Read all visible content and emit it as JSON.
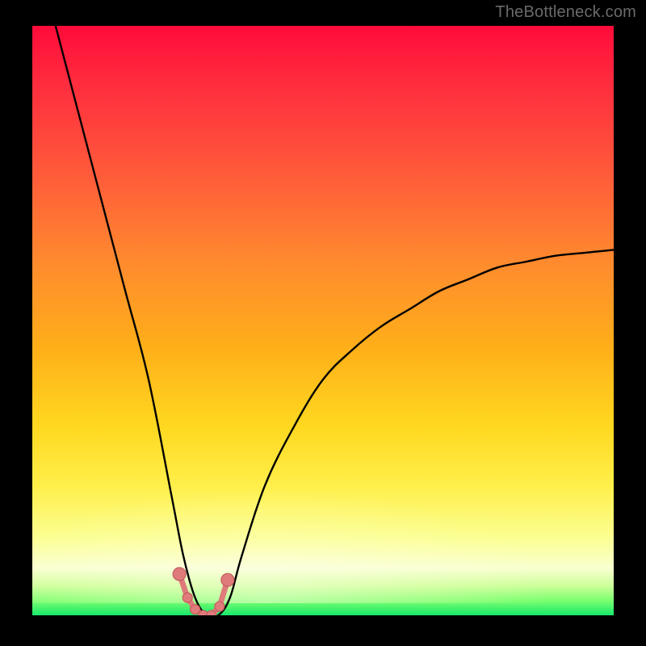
{
  "watermark": "TheBottleneck.com",
  "colors": {
    "frame": "#000000",
    "curve": "#000000",
    "marker_fill": "#e07b7b",
    "marker_stroke": "#c35d5d",
    "gradient_stops": [
      "#ff0b3a",
      "#ff2d3e",
      "#ff5a3a",
      "#ff8a2e",
      "#ffb019",
      "#ffd820",
      "#ffef4a",
      "#fbff93",
      "#f9ffd0",
      "#ccff99",
      "#7bff70",
      "#17e86b"
    ]
  },
  "chart_data": {
    "type": "line",
    "title": "",
    "xlabel": "",
    "ylabel": "",
    "xlim": [
      0,
      100
    ],
    "ylim": [
      0,
      100
    ],
    "note": "Values estimated from pixel positions; y is bottleneck percentage (0 at bottom/green, 100 at top/red). Curve dips to ~0 near x≈30 then rises toward ~62 at x=100.",
    "series": [
      {
        "name": "bottleneck-curve",
        "x": [
          4,
          8,
          12,
          16,
          20,
          24,
          26,
          28,
          30,
          32,
          34,
          36,
          40,
          45,
          50,
          55,
          60,
          65,
          70,
          75,
          80,
          85,
          90,
          95,
          100
        ],
        "y": [
          100,
          85,
          70,
          55,
          40,
          20,
          10,
          3,
          0,
          0,
          3,
          10,
          22,
          32,
          40,
          45,
          49,
          52,
          55,
          57,
          59,
          60,
          61,
          61.5,
          62
        ]
      }
    ],
    "markers": {
      "name": "highlighted-points",
      "note": "Salmon dot cluster at the valley bottom",
      "x": [
        25.3,
        26.7,
        28.0,
        29.4,
        30.8,
        32.2,
        33.6
      ],
      "y": [
        7,
        3,
        1,
        0,
        0,
        1.5,
        6
      ]
    }
  }
}
